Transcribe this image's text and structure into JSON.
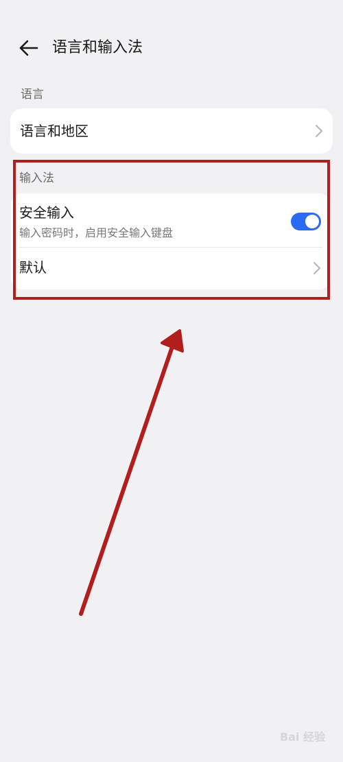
{
  "header": {
    "title": "语言和输入法"
  },
  "sections": {
    "language": {
      "label": "语言",
      "items": [
        {
          "title": "语言和地区"
        }
      ]
    },
    "input_method": {
      "label": "输入法",
      "secure_input": {
        "title": "安全输入",
        "subtitle": "输入密码时，启用安全输入键盘",
        "enabled": true
      },
      "default": {
        "title": "默认"
      }
    }
  },
  "colors": {
    "toggle_on": "#2b6bf3",
    "annotation_red": "#b01e1e"
  },
  "watermark": {
    "text": "Bai 经验"
  }
}
